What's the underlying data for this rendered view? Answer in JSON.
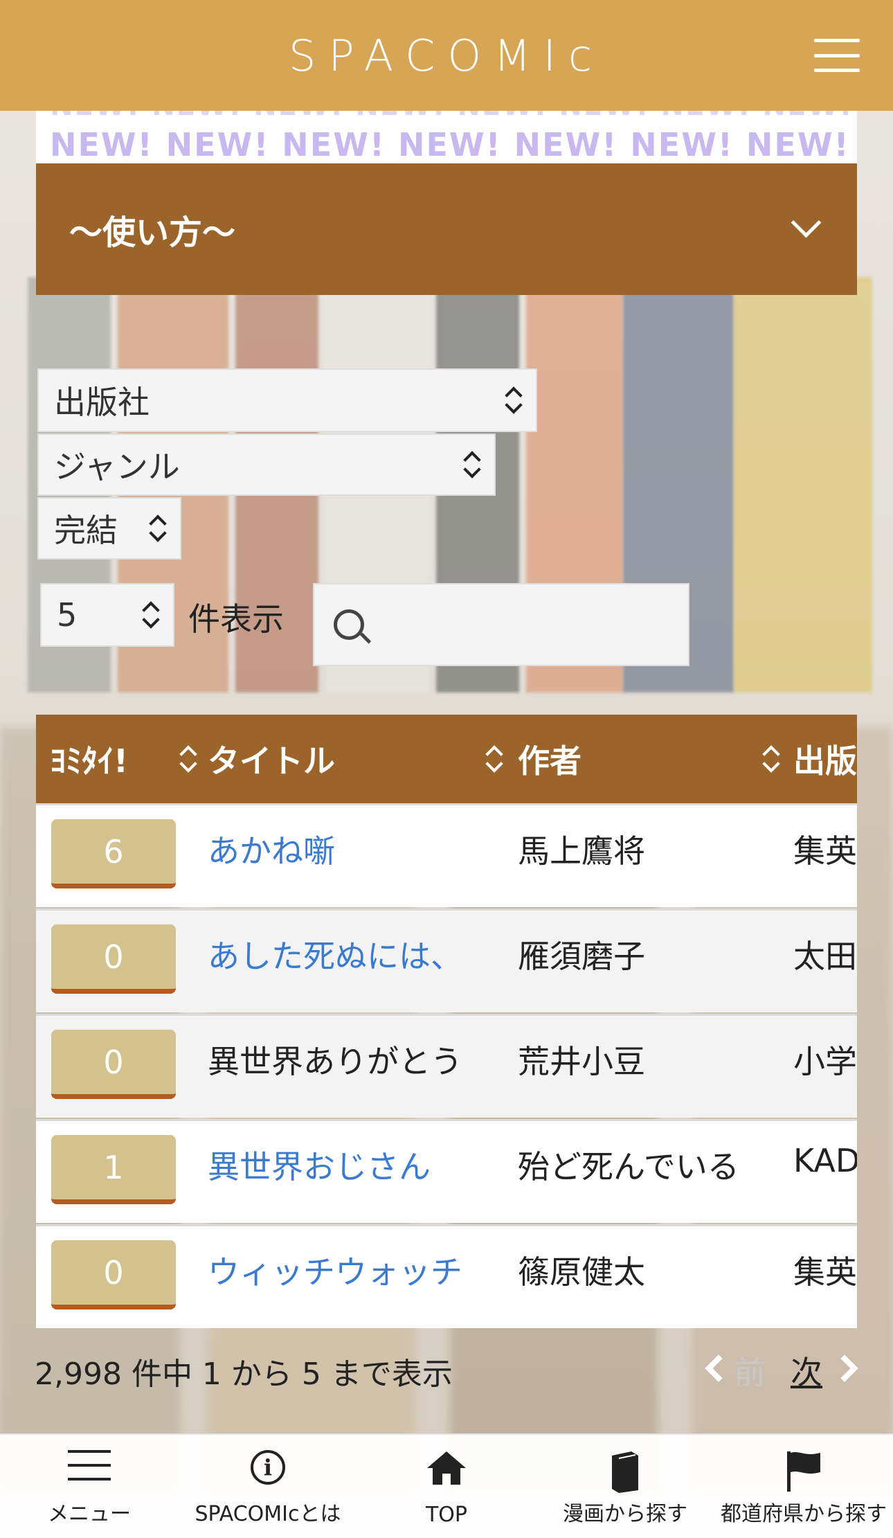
{
  "header": {
    "logo": "SPACOMIc"
  },
  "banner": {
    "marquee": "NEW! NEW! NEW! NEW! NEW! NEW! NEW! NEW! NEW!"
  },
  "accordion": {
    "title": "〜使い方〜"
  },
  "filters": {
    "publisher": "出版社",
    "genre": "ジャンル",
    "status": "完結",
    "page_size": "5",
    "page_size_suffix": "件表示",
    "search_value": ""
  },
  "table": {
    "columns": [
      "ﾖﾐﾀｲ!",
      "タイトル",
      "作者",
      "出版"
    ],
    "rows": [
      {
        "count": "6",
        "title": "あかね噺",
        "title_link": true,
        "author": "馬上鷹将",
        "publisher": "集英"
      },
      {
        "count": "0",
        "title": "あした死ぬには、",
        "title_link": true,
        "author": "雁須磨子",
        "publisher": "太田"
      },
      {
        "count": "0",
        "title": "異世界ありがとう",
        "title_link": false,
        "author": "荒井小豆",
        "publisher": "小学"
      },
      {
        "count": "1",
        "title": "異世界おじさん",
        "title_link": true,
        "author": "殆ど死んでいる",
        "publisher": "KAD"
      },
      {
        "count": "0",
        "title": "ウィッチウォッチ",
        "title_link": true,
        "author": "篠原健太",
        "publisher": "集英"
      }
    ]
  },
  "pagination": {
    "info": "2,998 件中 1 から 5 まで表示",
    "prev": "前",
    "next": "次"
  },
  "tabbar": [
    {
      "label": "メニュー",
      "icon": "menu-icon"
    },
    {
      "label": "SPACOMIcとは",
      "icon": "info-icon"
    },
    {
      "label": "TOP",
      "icon": "home-icon"
    },
    {
      "label": "漫画から探す",
      "icon": "book-icon"
    },
    {
      "label": "都道府県から探す",
      "icon": "flag-icon"
    }
  ],
  "colors": {
    "header": "#d6a555",
    "accent": "#9b642a",
    "link": "#3a7bd0",
    "button": "#d4c28e"
  }
}
